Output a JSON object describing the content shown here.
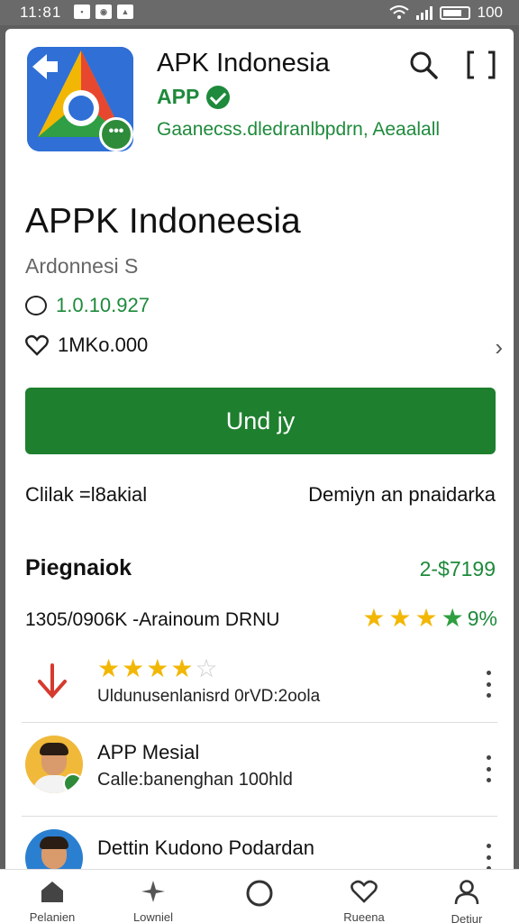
{
  "status_bar": {
    "time": "11:81",
    "battery": "100"
  },
  "header": {
    "app_name": "APK Indonesia",
    "tag": "APP",
    "subtitle": "Gaanecss.dledranlbpdrn, Aeaalall"
  },
  "app": {
    "title": "APPK Indoneesia",
    "developer": "Ardonnesi S",
    "reviews_count": "1.0.10.927",
    "likes_count": "1MKo.000"
  },
  "download_button": "Und jy",
  "info": {
    "left": "Clilak =l8akial",
    "right": "Demiyn an pnaidarka"
  },
  "section": {
    "title": "Piegnaiok",
    "value": "2-$7199",
    "stats_text": "1305/0906K -Arainoum DRNU",
    "rating_text": "9%",
    "rating_stars": 4
  },
  "list": [
    {
      "type": "rating",
      "stars": 4,
      "text": "Uldunusenlanisrd 0rVD:2oola"
    },
    {
      "type": "user",
      "title": "APP Mesial",
      "subtitle": "Calle:banenghan 100hld"
    },
    {
      "type": "user",
      "title": "Dettin Kudono Podardan",
      "subtitle": ""
    }
  ],
  "bottom_nav": [
    {
      "label": "Pelanien",
      "icon": "home-icon"
    },
    {
      "label": "Lowniel",
      "icon": "sparkle-icon"
    },
    {
      "label": "",
      "icon": "circle-icon"
    },
    {
      "label": "Rueena",
      "icon": "heart-icon"
    },
    {
      "label": "Detiur",
      "icon": "profile-icon"
    }
  ],
  "colors": {
    "accent": "#1e7f2e",
    "star": "#f2b705",
    "arrow": "#d63a2f"
  }
}
